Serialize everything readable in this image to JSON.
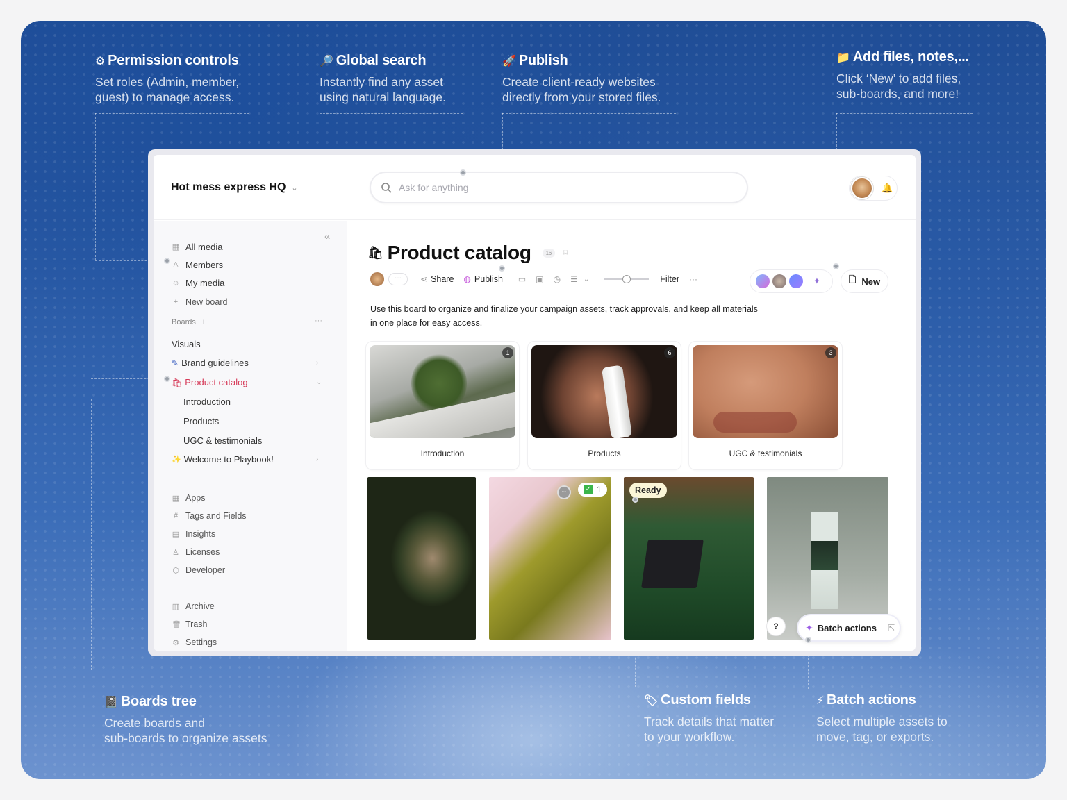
{
  "callouts": {
    "permission": {
      "title": "Permission controls",
      "desc1": "Set roles (Admin, member,",
      "desc2": "guest) to manage access."
    },
    "search": {
      "title": "Global search",
      "desc1": "Instantly find any asset",
      "desc2": "using natural language."
    },
    "publish": {
      "title": "Publish",
      "desc1": "Create client-ready websites",
      "desc2": "directly from your stored files."
    },
    "add": {
      "title": "Add files, notes,...",
      "desc1": "Click ‘New’ to add files,",
      "desc2": "sub-boards, and more!"
    },
    "boards": {
      "title": "Boards tree",
      "desc1": "Create boards and",
      "desc2": "sub-boards to organize assets"
    },
    "fields": {
      "title": "Custom fields",
      "desc1": "Track details that matter",
      "desc2": "to your workflow."
    },
    "batch": {
      "title": "Batch actions",
      "desc1": "Select multiple assets to",
      "desc2": "move, tag, or exports."
    }
  },
  "header": {
    "workspace": "Hot mess express HQ",
    "search_placeholder": "Ask for anything"
  },
  "sidebar": {
    "top": [
      "All media",
      "Members",
      "My media",
      "New board"
    ],
    "boards_label": "Boards",
    "boards": [
      "Visuals",
      "Brand guidelines",
      "Product catalog",
      "Introduction",
      "Products",
      "UGC & testimonials",
      "Welcome to Playbook!"
    ],
    "tools": [
      "Apps",
      "Tags and Fields",
      "Insights",
      "Licenses",
      "Developer"
    ],
    "bottom": [
      "Archive",
      "Trash",
      "Settings"
    ]
  },
  "main": {
    "title": "Product catalog",
    "count": "16",
    "share": "Share",
    "publish": "Publish",
    "filter": "Filter",
    "new": "New",
    "description": "Use this board to organize and finalize your campaign assets, track approvals, and keep all materials in one place for easy access.",
    "cards": [
      {
        "label": "Introduction",
        "count": "1"
      },
      {
        "label": "Products",
        "count": "6"
      },
      {
        "label": "UGC & testimonials",
        "count": "3"
      }
    ],
    "ready": "Ready",
    "check_count": "1",
    "help": "?",
    "batch": "Batch actions"
  }
}
